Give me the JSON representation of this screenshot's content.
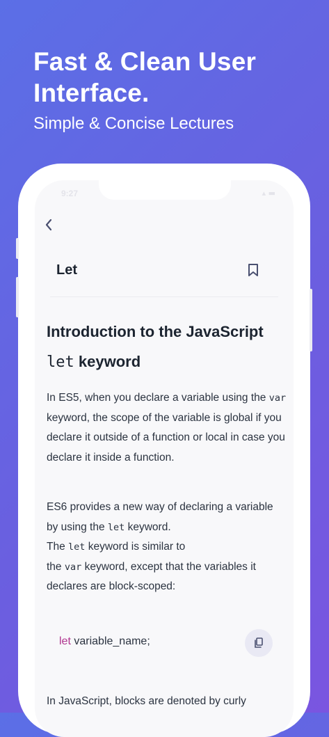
{
  "promo": {
    "title": "Fast & Clean User Interface.",
    "subtitle": "Simple & Concise Lectures"
  },
  "status_bar": {
    "time": "9:27"
  },
  "header": {
    "title": "Let"
  },
  "article": {
    "heading_part1": "Introduction to the JavaScript",
    "heading_code": "let",
    "heading_part2": "keyword",
    "p1": {
      "a": "In ES5, when you declare a variable using the",
      "code": "var",
      "b": "keyword, the scope of the variable is global if you declare it outside of a function or local in case you declare it inside a function."
    },
    "p2": {
      "a": "ES6 provides a new way of declaring a variable by using the",
      "code1": "let",
      "b": "keyword.",
      "c": "The",
      "code2": "let",
      "d": "keyword is similar to",
      "e": "the",
      "code3": "var",
      "f": "keyword, except that the variables it declares are block-scoped:"
    },
    "code_block": {
      "keyword": "let",
      "rest": "variable_name;"
    },
    "p3": "In JavaScript, blocks are denoted by curly"
  },
  "icons": {
    "back": "chevron-left-icon",
    "bookmark": "bookmark-icon",
    "copy": "copy-icon"
  },
  "colors": {
    "background_start": "#5b6fe6",
    "background_end": "#7a55e0",
    "keyword": "#b0368f",
    "icon": "#4a5070"
  }
}
